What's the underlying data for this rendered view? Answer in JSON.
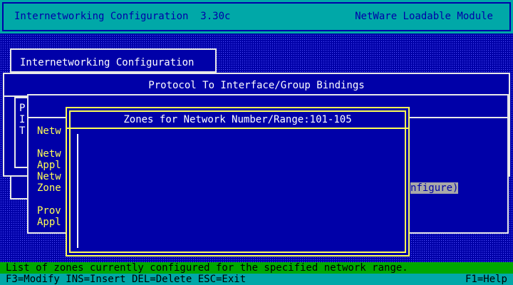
{
  "header": {
    "title": "Internetworking Configuration  3.30c",
    "module": "NetWare Loadable Module"
  },
  "menu_window": {
    "title": "Internetworking Configuration",
    "left_letters": [
      "P",
      "I",
      "T"
    ]
  },
  "bindings_window": {
    "title": "Protocol To Interface/Group Bindings"
  },
  "behind_fields": {
    "lines": [
      "Netw",
      "Netw",
      "Appl",
      "Netw",
      "Zone",
      "Prov",
      "Appl"
    ],
    "highlight_fragment": "nfigure)"
  },
  "zones_window": {
    "title": "Zones for Network Number/Range:101-105",
    "items": []
  },
  "status_bar": {
    "text": "List of zones currently configured for the specified network range."
  },
  "key_bar": {
    "left": "F3=Modify INS=Insert DEL=Delete ESC=Exit",
    "right": "F1=Help"
  },
  "colors": {
    "background": "#0000a8",
    "header": "#00a8a8",
    "status": "#00a800",
    "zones_frame": "#ffff55"
  }
}
